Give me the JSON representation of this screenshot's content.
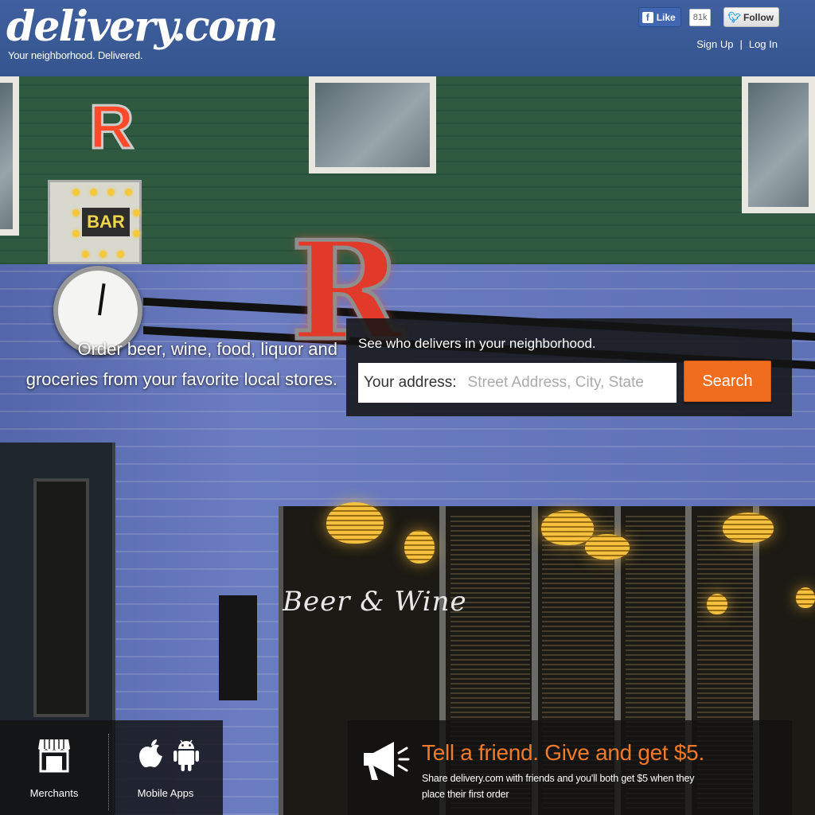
{
  "header": {
    "logo_text": "delivery.com",
    "logo_tagline": "Your neighborhood. Delivered.",
    "social": {
      "like_label": "Like",
      "like_count": "81k",
      "follow_label": "Follow"
    },
    "auth": {
      "signup": "Sign Up",
      "separator": "|",
      "login": "Log In"
    }
  },
  "hero": {
    "tagline": "Order beer, wine, food, liquor and groceries from your favorite local stores.",
    "sign_text": "Beer & Wine",
    "bar_sign": "BAR"
  },
  "search": {
    "hint": "See who delivers in your neighborhood.",
    "address_label": "Your address:",
    "address_placeholder": "Street Address, City, State",
    "address_value": "",
    "button_label": "Search"
  },
  "footer": {
    "merchants_label": "Merchants",
    "mobile_apps_label": "Mobile Apps",
    "promo_title": "Tell a friend. Give and get $5.",
    "promo_text": "Share delivery.com with friends and you'll both get $5 when they place their first order"
  },
  "colors": {
    "header_bg": "#3b5998",
    "accent_orange": "#ef6d1d",
    "promo_orange": "#f07a2a"
  },
  "icons": [
    "facebook-icon",
    "twitter-bird-icon",
    "storefront-icon",
    "apple-icon",
    "android-icon",
    "megaphone-icon"
  ]
}
